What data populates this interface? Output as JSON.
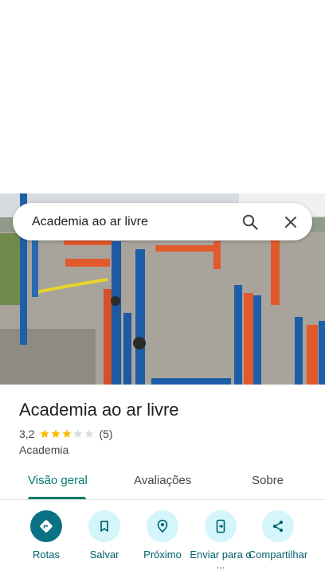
{
  "search": {
    "query": "Academia ao ar livre"
  },
  "place": {
    "title": "Academia ao ar livre",
    "rating": "3,2",
    "rating_value": 3.2,
    "stars_filled": 3,
    "stars_total": 5,
    "review_count": "(5)",
    "category": "Academia"
  },
  "tabs": [
    {
      "label": "Visão geral",
      "active": true
    },
    {
      "label": "Avaliações",
      "active": false
    },
    {
      "label": "Sobre",
      "active": false
    }
  ],
  "actions": [
    {
      "label": "Rotas",
      "icon": "directions-icon"
    },
    {
      "label": "Salvar",
      "icon": "bookmark-icon"
    },
    {
      "label": "Próximo",
      "icon": "nearby-icon"
    },
    {
      "label": "Enviar para o ...",
      "icon": "send-to-phone-icon"
    },
    {
      "label": "Compartilhar",
      "icon": "share-icon"
    }
  ],
  "colors": {
    "accent": "#00796b",
    "action_bg": "#d3f5fb",
    "primary_action_bg": "#0b7285",
    "star": "#fbbc04",
    "star_empty": "#dadce0"
  }
}
